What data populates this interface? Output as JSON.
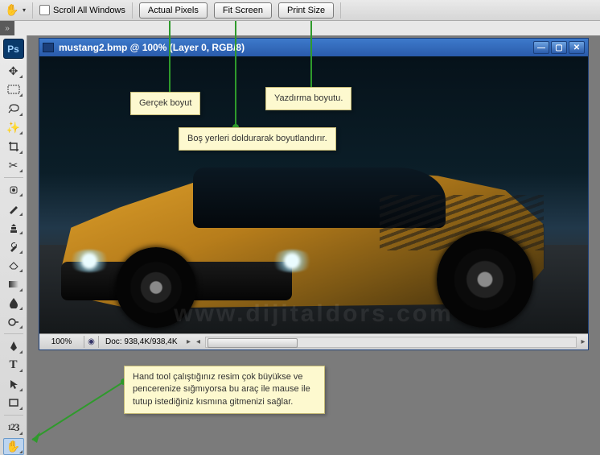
{
  "toolbar": {
    "scroll_all_windows_label": "Scroll All Windows",
    "actual_pixels": "Actual Pixels",
    "fit_screen": "Fit Screen",
    "print_size": "Print Size"
  },
  "toolbox": {
    "ps_label": "Ps",
    "numeric_label": "1 2 3"
  },
  "document": {
    "title": "mustang2.bmp @ 100% (Layer 0, RGB/8)",
    "zoom": "100%",
    "doc_info": "Doc: 938,4K/938,4K",
    "watermark": "www.dijitaldors.com"
  },
  "callouts": {
    "actual_pixels": "Gerçek boyut",
    "fit_screen": "Boş yerleri doldurarak boyutlandırır.",
    "print_size": "Yazdırma boyutu.",
    "hand_tool": "Hand tool çalıştığınız resim çok büyükse ve pencerenize sığmıyorsa bu araç ile mause ile tutup istediğiniz kısmına gitmenizi sağlar."
  }
}
